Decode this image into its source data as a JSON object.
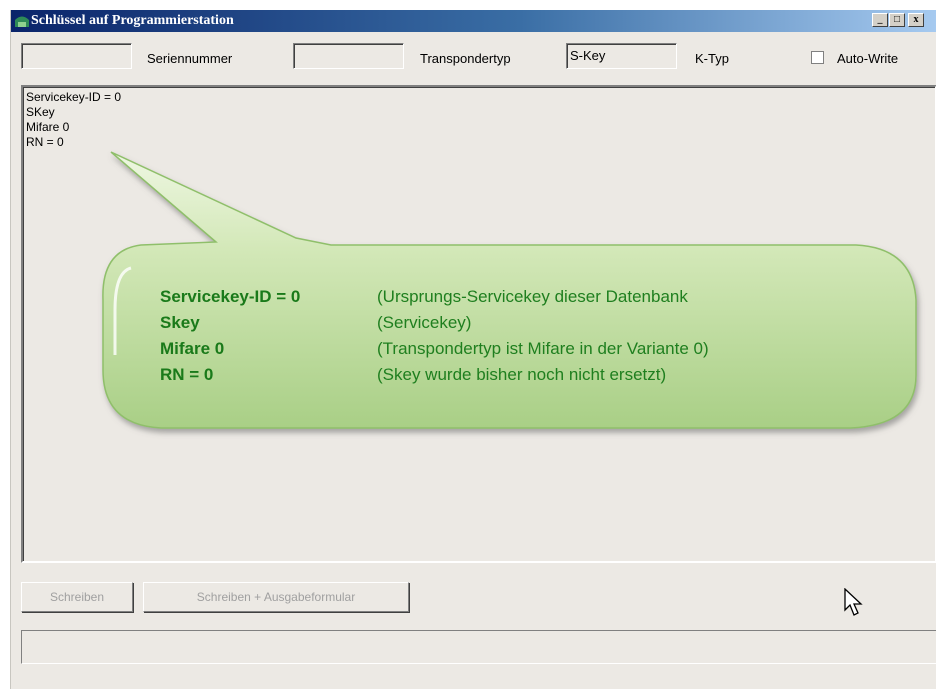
{
  "window": {
    "title": "Schlüssel auf Programmierstation",
    "controls": {
      "minimize": "_",
      "maximize": "□",
      "close": "x"
    }
  },
  "header": {
    "field1_value": "",
    "serial_label": "Seriennummer",
    "serial_value": "",
    "transponder_label": "Transpondertyp",
    "transponder_value": "S-Key",
    "ktype_label": "K-Typ",
    "autowrite_label": "Auto-Write",
    "autowrite_checked": false
  },
  "memo": {
    "lines": [
      "Servicekey-ID = 0",
      "SKey",
      "Mifare 0",
      "RN = 0"
    ]
  },
  "callout": {
    "rows": [
      {
        "key": "Servicekey-ID = 0",
        "desc": "(Ursprungs-Servicekey dieser Datenbank"
      },
      {
        "key": "Skey",
        "desc": "(Servicekey)"
      },
      {
        "key": "Mifare 0",
        "desc": "(Transpondertyp ist Mifare in der Variante 0)"
      },
      {
        "key": "RN = 0",
        "desc": "(Skey wurde bisher noch nicht ersetzt)"
      }
    ]
  },
  "buttons": {
    "write": "Schreiben",
    "write_form": "Schreiben + Ausgabeformular"
  },
  "status": {
    "text": ""
  }
}
